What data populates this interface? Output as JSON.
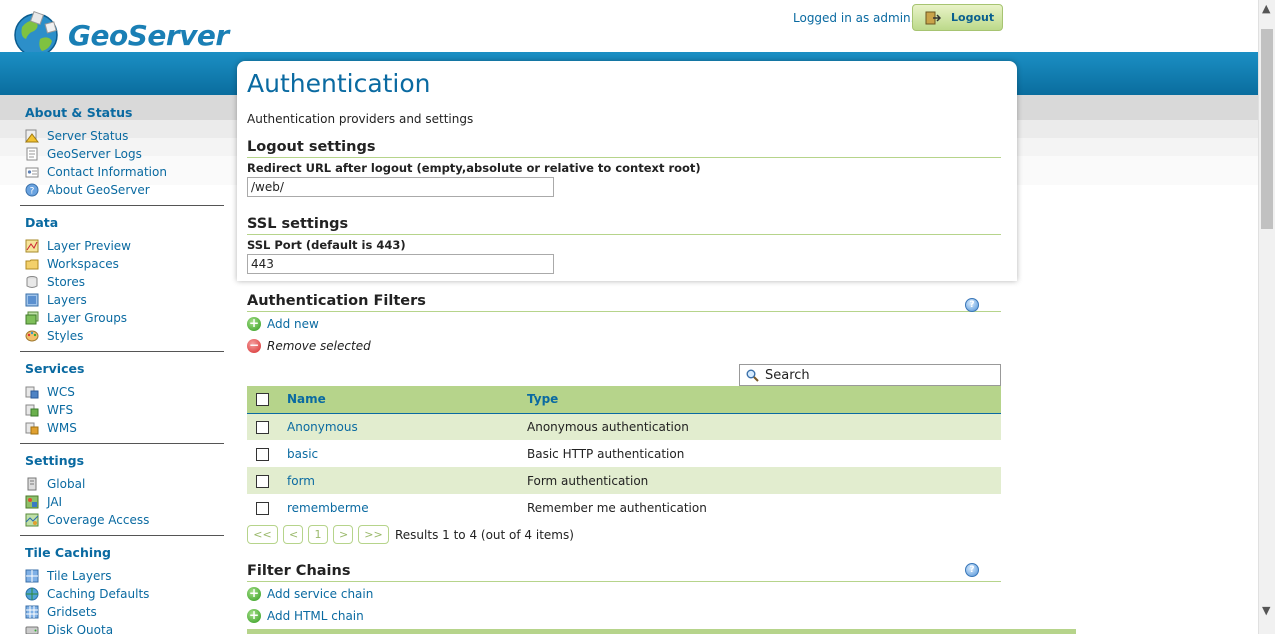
{
  "header": {
    "logo_text": "GeoServer",
    "login_text": "Logged in as admin.",
    "logout_label": "Logout"
  },
  "sidebar": {
    "sections": [
      {
        "title": "About & Status",
        "items": [
          {
            "label": "Server Status",
            "icon": "warning-icon"
          },
          {
            "label": "GeoServer Logs",
            "icon": "document-icon"
          },
          {
            "label": "Contact Information",
            "icon": "contact-card-icon"
          },
          {
            "label": "About GeoServer",
            "icon": "help-icon"
          }
        ]
      },
      {
        "title": "Data",
        "items": [
          {
            "label": "Layer Preview",
            "icon": "map-preview-icon"
          },
          {
            "label": "Workspaces",
            "icon": "folder-icon"
          },
          {
            "label": "Stores",
            "icon": "database-icon"
          },
          {
            "label": "Layers",
            "icon": "layer-icon"
          },
          {
            "label": "Layer Groups",
            "icon": "layer-group-icon"
          },
          {
            "label": "Styles",
            "icon": "palette-icon"
          }
        ]
      },
      {
        "title": "Services",
        "items": [
          {
            "label": "WCS",
            "icon": "wcs-service-icon"
          },
          {
            "label": "WFS",
            "icon": "wfs-service-icon"
          },
          {
            "label": "WMS",
            "icon": "wms-service-icon"
          }
        ]
      },
      {
        "title": "Settings",
        "items": [
          {
            "label": "Global",
            "icon": "server-icon"
          },
          {
            "label": "JAI",
            "icon": "jai-icon"
          },
          {
            "label": "Coverage Access",
            "icon": "coverage-icon"
          }
        ]
      },
      {
        "title": "Tile Caching",
        "items": [
          {
            "label": "Tile Layers",
            "icon": "tile-grid-icon"
          },
          {
            "label": "Caching Defaults",
            "icon": "globe-icon"
          },
          {
            "label": "Gridsets",
            "icon": "gridset-icon"
          },
          {
            "label": "Disk Quota",
            "icon": "disk-icon"
          }
        ]
      }
    ]
  },
  "page": {
    "title": "Authentication",
    "description": "Authentication providers and settings"
  },
  "logout_settings": {
    "heading": "Logout settings",
    "redirect_label": "Redirect URL after logout (empty,absolute or relative to context root)",
    "redirect_value": "/web/"
  },
  "ssl_settings": {
    "heading": "SSL settings",
    "port_label": "SSL Port (default is 443)",
    "port_value": "443"
  },
  "auth_filters": {
    "heading": "Authentication Filters",
    "add_label": "Add new",
    "remove_label": "Remove selected",
    "search_placeholder": "Search",
    "columns": [
      "Name",
      "Type"
    ],
    "rows": [
      {
        "name": "Anonymous",
        "type": "Anonymous authentication"
      },
      {
        "name": "basic",
        "type": "Basic HTTP authentication"
      },
      {
        "name": "form",
        "type": "Form authentication"
      },
      {
        "name": "rememberme",
        "type": "Remember me authentication"
      }
    ],
    "pager": {
      "first": "<<",
      "prev": "<",
      "page": "1",
      "next": ">",
      "last": ">>",
      "results": "Results 1 to 4 (out of 4 items)"
    }
  },
  "filter_chains": {
    "heading": "Filter Chains",
    "add_service_label": "Add service chain",
    "add_html_label": "Add HTML chain"
  },
  "colors": {
    "accent_blue": "#0a6aa1",
    "band_blue": "#1b8fc4",
    "table_green": "#b6d48b",
    "row_green": "#e2edcf"
  }
}
